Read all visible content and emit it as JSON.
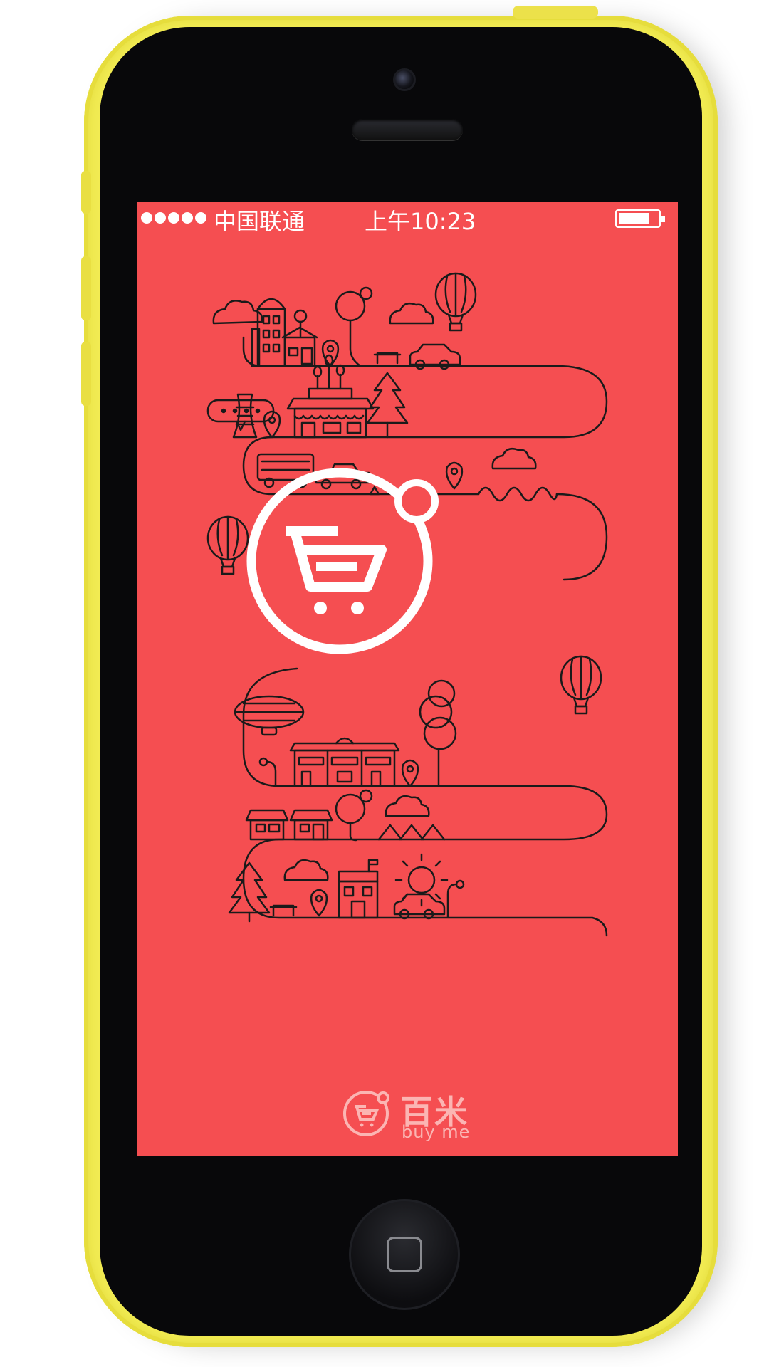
{
  "status_bar": {
    "carrier": "中国联通",
    "time": "上午10:23",
    "signal_bars": 5,
    "battery_level": 0.75
  },
  "brand": {
    "name": "百米",
    "slogan": "buy me"
  },
  "colors": {
    "screen_background": "#f54e51",
    "phone_body": "#f2ec54",
    "line_art": "#1a1a1a",
    "logo": "#ffffff",
    "brand_text": "#fbb5b3"
  },
  "icons": {
    "logo": "shopping-cart-icon",
    "illustration": "city-road-icon"
  }
}
